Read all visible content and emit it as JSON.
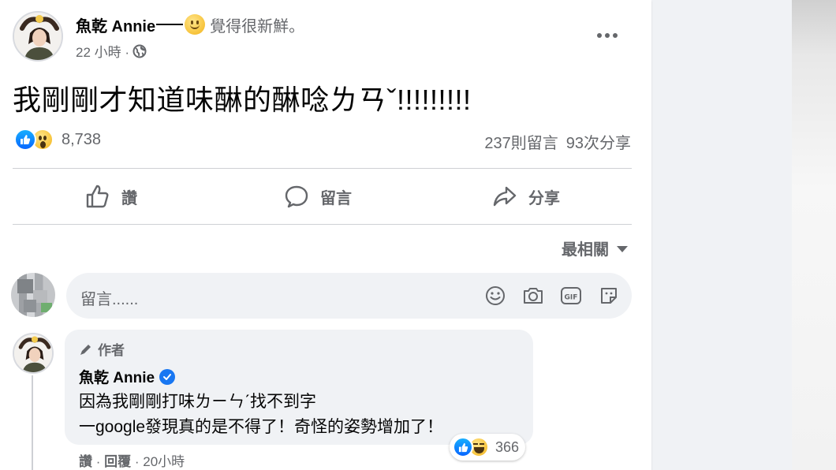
{
  "post": {
    "author": "魚乾 Annie",
    "feeling": "覺得很新鮮。",
    "time": "22 小時 ·",
    "text": "我剛剛才知道味醂的醂唸ㄌㄢˇ!!!!!!!!!",
    "reaction_count": "8,738",
    "comments_count": "237則留言",
    "shares_count": "93次分享"
  },
  "actions": {
    "like": "讚",
    "comment": "留言",
    "share": "分享"
  },
  "sort_label": "最相關",
  "comment_input": {
    "placeholder": "留言......"
  },
  "comment": {
    "badge": "作者",
    "author": "魚乾 Annie",
    "line1": "因為我剛剛打味ㄌㄧㄣˊ找不到字",
    "line2": "一google發現真的是不得了！奇怪的姿勢增加了！",
    "reaction_count": "366",
    "like": "讚",
    "reply": "回覆",
    "time": "20小時"
  },
  "colors": {
    "brand_blue": "#1877f2",
    "secondary_text": "#65676b",
    "input_bg": "#f0f2f5"
  }
}
